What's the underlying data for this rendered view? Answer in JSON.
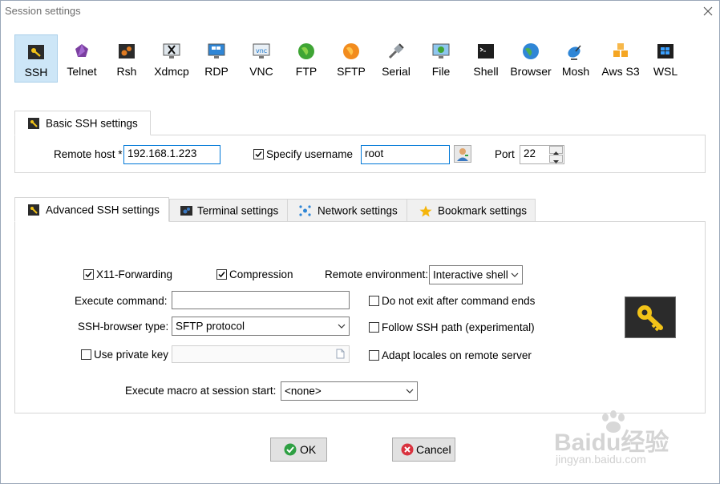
{
  "window": {
    "title": "Session settings"
  },
  "protocols": [
    {
      "label": "SSH",
      "icon": "ssh-key-icon",
      "selected": true
    },
    {
      "label": "Telnet",
      "icon": "telnet-icon"
    },
    {
      "label": "Rsh",
      "icon": "rsh-icon"
    },
    {
      "label": "Xdmcp",
      "icon": "xdmcp-icon"
    },
    {
      "label": "RDP",
      "icon": "rdp-icon"
    },
    {
      "label": "VNC",
      "icon": "vnc-icon"
    },
    {
      "label": "FTP",
      "icon": "ftp-globe-icon"
    },
    {
      "label": "SFTP",
      "icon": "sftp-globe-icon"
    },
    {
      "label": "Serial",
      "icon": "serial-plug-icon"
    },
    {
      "label": "File",
      "icon": "file-monitor-icon"
    },
    {
      "label": "Shell",
      "icon": "shell-terminal-icon"
    },
    {
      "label": "Browser",
      "icon": "browser-globe-icon"
    },
    {
      "label": "Mosh",
      "icon": "mosh-satellite-icon"
    },
    {
      "label": "Aws S3",
      "icon": "aws-s3-cubes-icon"
    },
    {
      "label": "WSL",
      "icon": "wsl-windows-icon"
    }
  ],
  "basic": {
    "tab_label": "Basic SSH settings",
    "remote_host_label": "Remote host *",
    "remote_host_value": "192.168.1.223",
    "specify_username_label": "Specify username",
    "specify_username_checked": true,
    "username_value": "root",
    "port_label": "Port",
    "port_value": "22"
  },
  "advanced_tabs": [
    {
      "label": "Advanced SSH settings",
      "active": true
    },
    {
      "label": "Terminal settings"
    },
    {
      "label": "Network settings"
    },
    {
      "label": "Bookmark settings"
    }
  ],
  "advanced": {
    "x11_label": "X11-Forwarding",
    "x11_checked": true,
    "compression_label": "Compression",
    "compression_checked": true,
    "remote_env_label": "Remote environment:",
    "remote_env_value": "Interactive shell",
    "execute_command_label": "Execute command:",
    "execute_command_value": "",
    "do_not_exit_label": "Do not exit after command ends",
    "ssh_browser_label": "SSH-browser type:",
    "ssh_browser_value": "SFTP protocol",
    "follow_ssh_path_label": "Follow SSH path (experimental)",
    "use_private_key_label": "Use private key",
    "private_key_value": "",
    "adapt_locales_label": "Adapt locales on remote server",
    "macro_label": "Execute macro at session start:",
    "macro_value": "<none>"
  },
  "buttons": {
    "ok": "OK",
    "cancel": "Cancel"
  },
  "watermark": {
    "brand": "Baidu经验",
    "url": "jingyan.baidu.com"
  },
  "colors": {
    "selected_bg": "#cde6f7",
    "focus_border": "#0078d7",
    "ok_green": "#2ea043",
    "cancel_red": "#d9333f"
  }
}
